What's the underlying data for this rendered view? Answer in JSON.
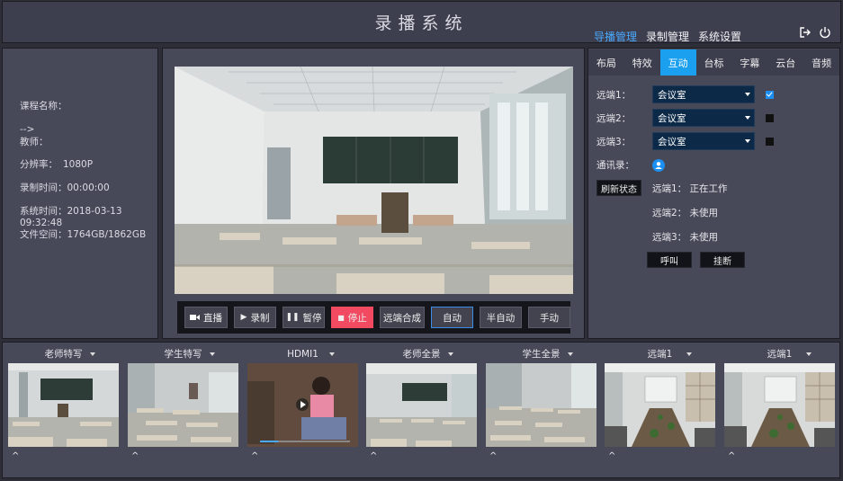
{
  "header": {
    "title": "录播系统",
    "nav": [
      "导播管理",
      "录制管理",
      "系统设置"
    ],
    "active_nav": 0,
    "icons": [
      "logout-icon",
      "power-icon"
    ]
  },
  "info": {
    "course_label": "课程名称：",
    "arrow": "-->",
    "teacher_label": "教师：",
    "resolution_label": "分辨率：",
    "resolution_value": "1080P",
    "rectime_label": "录制时间：",
    "rectime_value": "00:00:00",
    "systime_label": "系统时间：",
    "systime_value": "2018-03-13 09:32:48",
    "storage_label": "文件空间：",
    "storage_value": "1764GB/1862GB"
  },
  "controls": {
    "live": "直播",
    "record": "录制",
    "pause": "暂停",
    "stop": "停止",
    "remote_mix": "远端合成",
    "auto": "自动",
    "semi_auto": "半自动",
    "manual": "手动"
  },
  "right": {
    "tabs": [
      "布局",
      "特效",
      "互动",
      "台标",
      "字幕",
      "云台",
      "音频"
    ],
    "active_tab": 2,
    "remotes": [
      {
        "label": "远端1：",
        "value": "会议室",
        "checked": true
      },
      {
        "label": "远端2：",
        "value": "会议室",
        "checked": false
      },
      {
        "label": "远端3：",
        "value": "会议室",
        "checked": false
      }
    ],
    "contacts_label": "通讯录：",
    "refresh_label": "刷新状态",
    "statuses": [
      {
        "name": "远端1：",
        "state": "正在工作"
      },
      {
        "name": "远端2：",
        "state": "未使用"
      },
      {
        "name": "远端3：",
        "state": "未使用"
      }
    ],
    "call_label": "呼叫",
    "hangup_label": "挂断"
  },
  "thumbnails": [
    {
      "label": "老师特写",
      "scene": "teacher-closeup"
    },
    {
      "label": "学生特写",
      "scene": "student-closeup"
    },
    {
      "label": "HDMI1",
      "scene": "hdmi"
    },
    {
      "label": "老师全景",
      "scene": "teacher-wide"
    },
    {
      "label": "学生全景",
      "scene": "student-wide"
    },
    {
      "label": "远端1",
      "scene": "remote"
    },
    {
      "label": "远端1",
      "scene": "remote"
    }
  ],
  "thumb_toggle": "^",
  "colors": {
    "accent": "#1aa0ef",
    "stop": "#f24a61",
    "nav_active": "#4aa9ff"
  }
}
